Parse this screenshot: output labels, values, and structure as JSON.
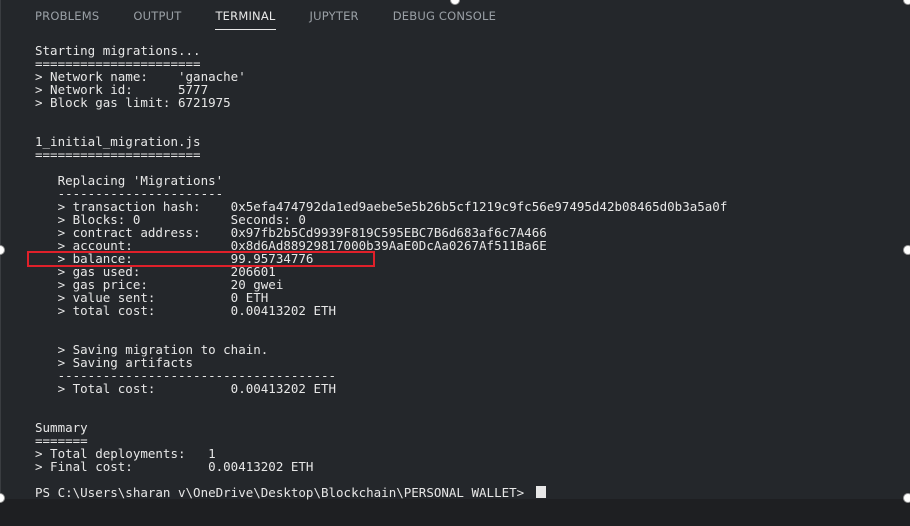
{
  "panel": {
    "tabs": [
      {
        "label": "PROBLEMS"
      },
      {
        "label": "OUTPUT"
      },
      {
        "label": "TERMINAL"
      },
      {
        "label": "JUPYTER"
      },
      {
        "label": "DEBUG CONSOLE"
      }
    ]
  },
  "terminal": {
    "lines": [
      "Starting migrations...",
      "======================",
      "> Network name:    'ganache'",
      "> Network id:      5777",
      "> Block gas limit: 6721975",
      "",
      "",
      "1_initial_migration.js",
      "======================",
      "",
      "   Replacing 'Migrations'",
      "   ----------------------",
      "   > transaction hash:    0x5efa474792da1ed9aebe5e5b26b5cf1219c9fc56e97495d42b08465d0b3a5a0f",
      "   > Blocks: 0            Seconds: 0",
      "   > contract address:    0x97fb2b5Cd9939F819C595EBC7B6d683af6c7A466",
      "   > account:             0x8d6Ad88929817000b39AaE0DcAa0267Af511Ba6E",
      "   > balance:             99.95734776",
      "   > gas used:            206601",
      "   > gas price:           20 gwei",
      "   > value sent:          0 ETH",
      "   > total cost:          0.00413202 ETH",
      "",
      "",
      "   > Saving migration to chain.",
      "   > Saving artifacts",
      "   -------------------------------------",
      "   > Total cost:          0.00413202 ETH",
      "",
      "",
      "Summary",
      "=======",
      "> Total deployments:   1",
      "> Final cost:          0.00413202 ETH",
      ""
    ],
    "prompt": "PS C:\\Users\\sharan v\\OneDrive\\Desktop\\Blockchain\\PERSONAL WALLET> "
  }
}
